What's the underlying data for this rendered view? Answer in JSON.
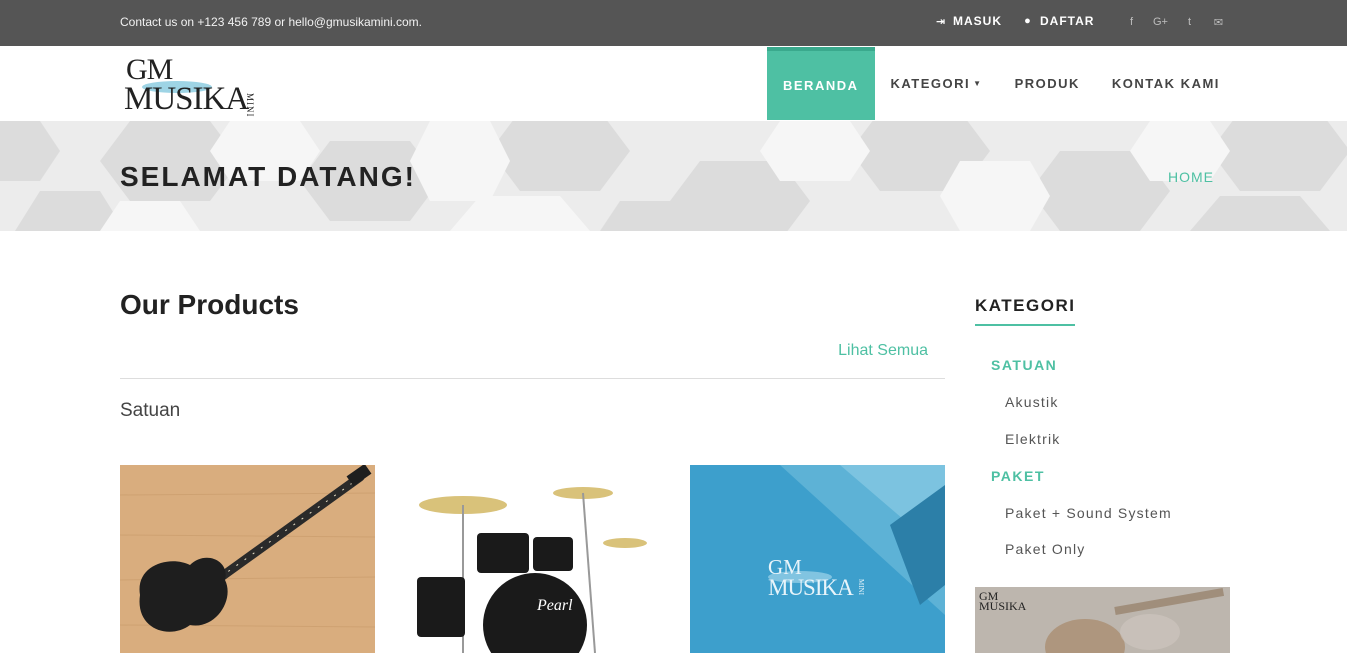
{
  "topbar": {
    "contact": "Contact us on +123 456 789 or hello@gmusikamini.com.",
    "login": "MASUK",
    "register": "DAFTAR",
    "social": [
      "facebook-icon",
      "google-plus-icon",
      "twitter-icon",
      "email-icon"
    ]
  },
  "logo": {
    "gm": "GM",
    "musika": "MUSIKA",
    "mini": "MINI"
  },
  "nav": {
    "items": [
      {
        "label": "BERANDA",
        "active": true
      },
      {
        "label": "KATEGORI",
        "dropdown": true
      },
      {
        "label": "PRODUK"
      },
      {
        "label": "KONTAK KAMI"
      }
    ]
  },
  "banner": {
    "title": "SELAMAT DATANG!",
    "breadcrumb": "HOME"
  },
  "main": {
    "heading": "Our Products",
    "see_all": "Lihat Semua",
    "section": "Satuan",
    "cards": [
      {
        "name": "electric-guitar"
      },
      {
        "name": "drum-kit"
      },
      {
        "name": "gm-musika-placeholder",
        "gm": "GM",
        "musika": "MUSIKA",
        "mini": "MINI"
      }
    ]
  },
  "sidebar": {
    "title": "KATEGORI",
    "groups": [
      {
        "label": "SATUAN",
        "items": [
          "Akustik",
          "Elektrik"
        ]
      },
      {
        "label": "PAKET",
        "items": [
          "Paket + Sound System",
          "Paket Only"
        ]
      }
    ],
    "thumb": {
      "gm": "GM",
      "musika": "MUSIKA"
    }
  },
  "colors": {
    "accent": "#4ec0a3",
    "topbar": "#555555"
  }
}
